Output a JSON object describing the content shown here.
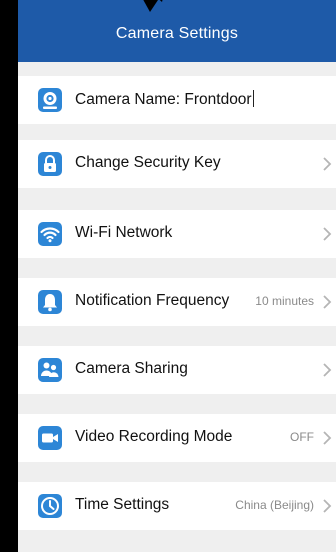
{
  "header": {
    "title": "Camera Settings"
  },
  "items": [
    {
      "label": "Camera Name: Frontdoor",
      "value": "",
      "icon": "camera-icon",
      "chevron": false
    },
    {
      "label": "Change Security Key",
      "value": "",
      "icon": "lock-icon",
      "chevron": true
    },
    {
      "label": "Wi-Fi Network",
      "value": "",
      "icon": "wifi-icon",
      "chevron": true
    },
    {
      "label": "Notification Frequency",
      "value": "10 minutes",
      "icon": "bell-icon",
      "chevron": true
    },
    {
      "label": "Camera Sharing",
      "value": "",
      "icon": "people-icon",
      "chevron": true
    },
    {
      "label": "Video Recording Mode",
      "value": "OFF",
      "icon": "video-camera-icon",
      "chevron": true
    },
    {
      "label": "Time Settings",
      "value": "China (Beijing)",
      "icon": "clock-icon",
      "chevron": true
    }
  ],
  "colors": {
    "header_bg": "#1e5aa8",
    "icon_bg": "#2d86d6",
    "page_bg": "#efefef"
  }
}
